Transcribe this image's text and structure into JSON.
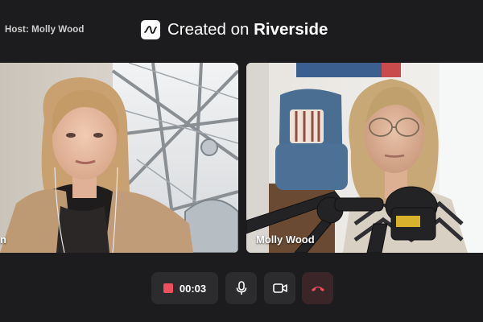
{
  "header": {
    "host_label": "Host: Molly Wood",
    "brand_prefix": "Created on ",
    "brand_name": "Riverside"
  },
  "participants": [
    {
      "name": "n"
    },
    {
      "name": "Molly Wood"
    }
  ],
  "controls": {
    "record_time": "00:03",
    "record_color": "#ef4f5a",
    "icons": [
      "record-icon",
      "microphone-icon",
      "camera-icon",
      "end-call-icon"
    ]
  }
}
